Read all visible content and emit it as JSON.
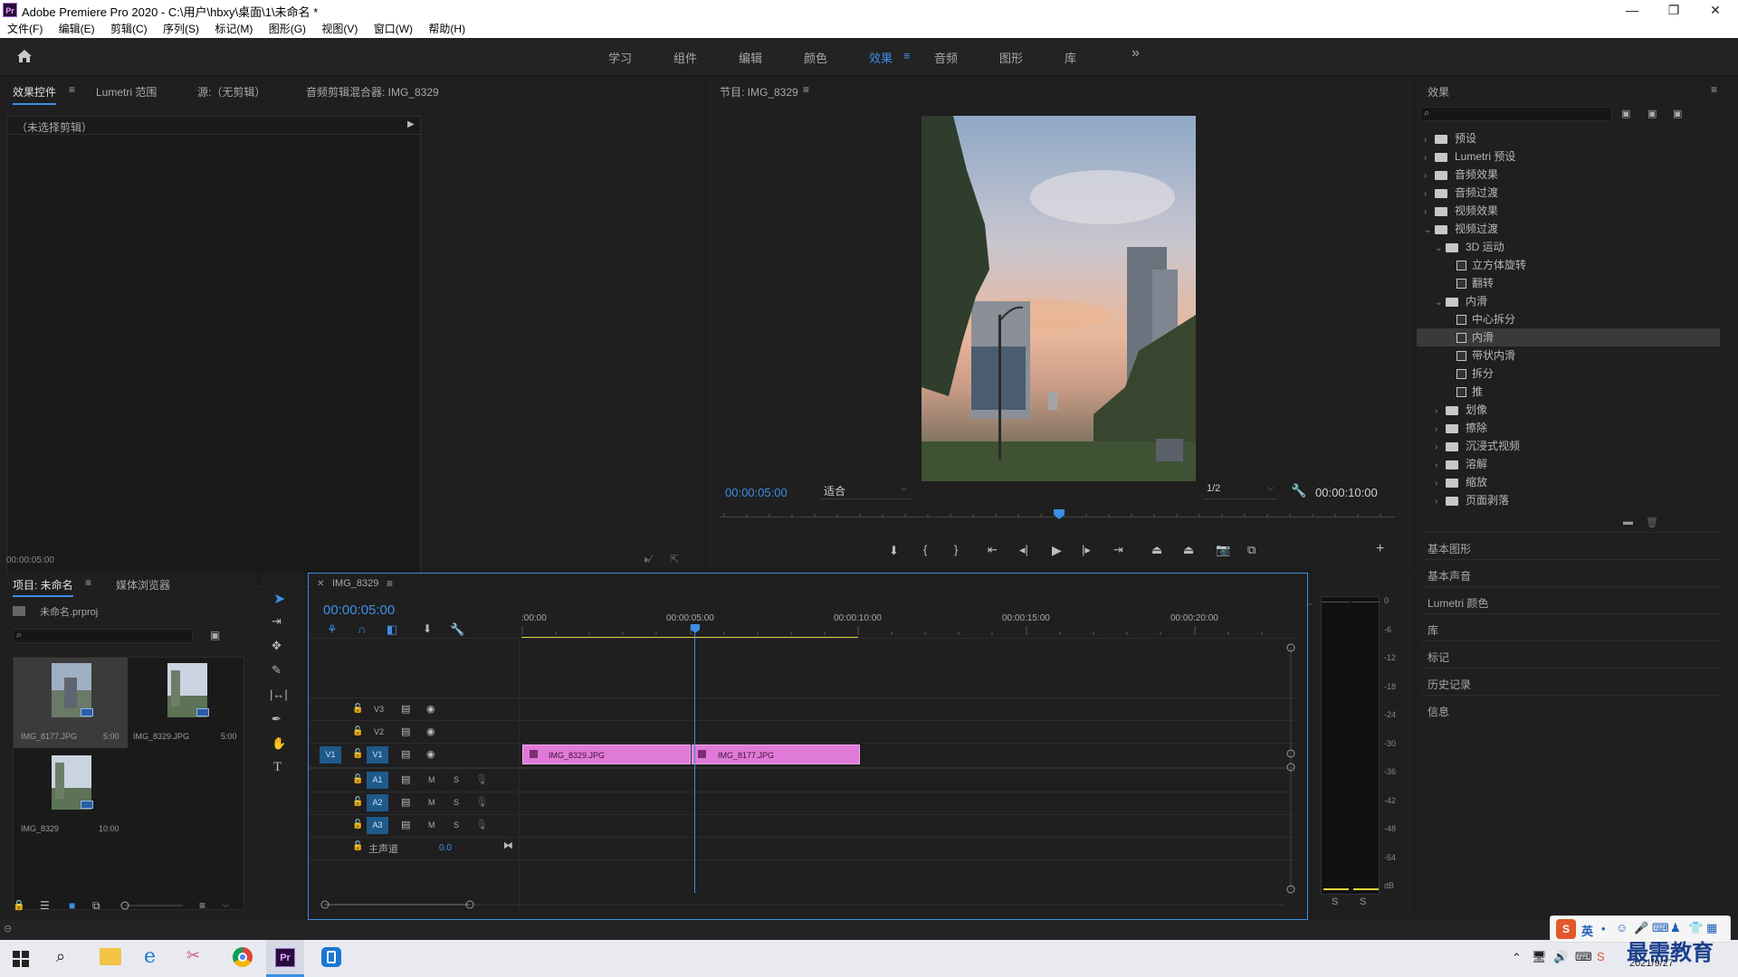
{
  "window": {
    "title": "Adobe Premiere Pro 2020 - C:\\用户\\hbxy\\桌面\\1\\未命名 *",
    "minimize": "—",
    "maximize": "❐",
    "close": "✕"
  },
  "menu": [
    "文件(F)",
    "编辑(E)",
    "剪辑(C)",
    "序列(S)",
    "标记(M)",
    "图形(G)",
    "视图(V)",
    "窗口(W)",
    "帮助(H)"
  ],
  "workspaces": {
    "items": [
      "学习",
      "组件",
      "编辑",
      "颜色",
      "效果",
      "音频",
      "图形",
      "库"
    ],
    "active": "效果",
    "more": "»"
  },
  "source_panel": {
    "tabs": [
      "效果控件",
      "Lumetri 范围",
      "源:（无剪辑）",
      "音频剪辑混合器: IMG_8329"
    ],
    "no_clip": "（未选择剪辑）",
    "timecode": "00:00:05:00"
  },
  "program": {
    "title": "节目: IMG_8329",
    "timecode": "00:00:05:00",
    "fit": "适合",
    "res": "1/2",
    "duration": "00:00:10:00"
  },
  "effects": {
    "title": "效果",
    "tree": [
      {
        "label": "预设",
        "level": 0,
        "type": "folder",
        "open": false
      },
      {
        "label": "Lumetri 预设",
        "level": 0,
        "type": "folder",
        "open": false
      },
      {
        "label": "音频效果",
        "level": 0,
        "type": "folder",
        "open": false
      },
      {
        "label": "音频过渡",
        "level": 0,
        "type": "folder",
        "open": false
      },
      {
        "label": "视频效果",
        "level": 0,
        "type": "folder",
        "open": false
      },
      {
        "label": "视频过渡",
        "level": 0,
        "type": "folder",
        "open": true
      },
      {
        "label": "3D 运动",
        "level": 1,
        "type": "folder",
        "open": true
      },
      {
        "label": "立方体旋转",
        "level": 2,
        "type": "fx"
      },
      {
        "label": "翻转",
        "level": 2,
        "type": "fx"
      },
      {
        "label": "内滑",
        "level": 1,
        "type": "folder",
        "open": true
      },
      {
        "label": "中心拆分",
        "level": 2,
        "type": "fx"
      },
      {
        "label": "内滑",
        "level": 2,
        "type": "fx",
        "selected": true
      },
      {
        "label": "带状内滑",
        "level": 2,
        "type": "fx"
      },
      {
        "label": "拆分",
        "level": 2,
        "type": "fx"
      },
      {
        "label": "推",
        "level": 2,
        "type": "fx"
      },
      {
        "label": "划像",
        "level": 1,
        "type": "folder",
        "open": false
      },
      {
        "label": "擦除",
        "level": 1,
        "type": "folder",
        "open": false
      },
      {
        "label": "沉浸式视频",
        "level": 1,
        "type": "folder",
        "open": false
      },
      {
        "label": "溶解",
        "level": 1,
        "type": "folder",
        "open": false
      },
      {
        "label": "缩放",
        "level": 1,
        "type": "folder",
        "open": false
      },
      {
        "label": "页面剥落",
        "level": 1,
        "type": "folder",
        "open": false
      }
    ]
  },
  "side_panels": [
    "基本图形",
    "基本声音",
    "Lumetri 颜色",
    "库",
    "标记",
    "历史记录",
    "信息"
  ],
  "project": {
    "tabs": [
      "项目: 未命名",
      "媒体浏览器"
    ],
    "file": "未命名.prproj",
    "items": [
      {
        "name": "IMG_8177.JPG",
        "dur": "5:00"
      },
      {
        "name": "IMG_8329.JPG",
        "dur": "5:00"
      },
      {
        "name": "IMG_8329",
        "dur": "10:00"
      }
    ]
  },
  "timeline": {
    "tab": "IMG_8329",
    "timecode": "00:00:05:00",
    "ruler": [
      ":00:00",
      "00:00:05:00",
      "00:00:10:00",
      "00:00:15:00",
      "00:00:20:00"
    ],
    "vtracks": [
      "V3",
      "V2",
      "V1"
    ],
    "atracks": [
      "A1",
      "A2",
      "A3"
    ],
    "src_v": "V1",
    "master": "主声道",
    "master_val": "0.0",
    "m": "M",
    "s": "S",
    "clips": [
      "IMG_8329.JPG",
      "IMG_8177.JPG"
    ]
  },
  "meter": {
    "scale": [
      "0",
      "-6",
      "-12",
      "-18",
      "-24",
      "-30",
      "-36",
      "-42",
      "-48",
      "-54",
      "dB"
    ],
    "solo": [
      "S",
      "S"
    ]
  },
  "taskbar": {
    "date": "2021/9/27",
    "ime": "英",
    "watermark": "最需教育"
  }
}
